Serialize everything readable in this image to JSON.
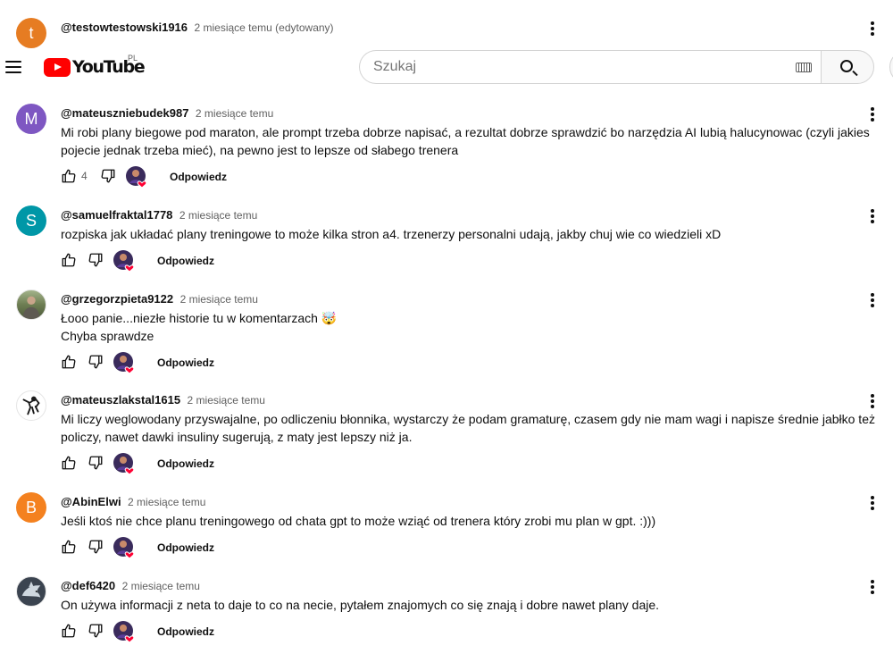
{
  "masthead": {
    "logo_text": "YouTube",
    "region": "PL",
    "search_placeholder": "Szukaj"
  },
  "top_comment": {
    "avatar_letter": "t",
    "avatar_color": "#e67c22",
    "author": "@testowtestowski1916",
    "time": "2 miesiące temu (edytowany)"
  },
  "reply_label": "Odpowiedz",
  "comments": [
    {
      "author": "@mateuszniebudek987",
      "time": "2 miesiące temu",
      "avatar_letter": "M",
      "avatar_color": "#7e57c2",
      "text": "Mi robi plany biegowe pod maraton, ale prompt trzeba dobrze napisać, a rezultat dobrze sprawdzić bo narzędzia AI lubią halucynowac (czyli jakies pojecie jednak trzeba mieć), na pewno jest to lepsze od słabego trenera",
      "likes": "4"
    },
    {
      "author": "@samuelfraktal1778",
      "time": "2 miesiące temu",
      "avatar_letter": "S",
      "avatar_color": "#0097a7",
      "text": "rozpiska jak układać plany treningowe to może kilka stron a4. trzenerzy personalni udają, jakby chuj wie co wiedzieli xD",
      "likes": ""
    },
    {
      "author": "@grzegorzpieta9122",
      "time": "2 miesiące temu",
      "avatar_letter": "",
      "avatar_color": "#7a8a5a",
      "text_line1": "Łooo panie...niezłe historie tu w komentarzach 🤯",
      "text_line2": "Chyba sprawdze",
      "likes": ""
    },
    {
      "author": "@mateuszlakstal1615",
      "time": "2 miesiące temu",
      "avatar_letter": "",
      "avatar_color": "#ffffff",
      "text": "Mi liczy weglowodany przyswajalne, po odliczeniu błonnika, wystarczy że podam gramaturę, czasem gdy nie mam wagi i napisze średnie jabłko też policzy, nawet dawki insuliny sugerują, z maty jest lepszy niż ja.",
      "likes": ""
    },
    {
      "author": "@AbinElwi",
      "time": "2 miesiące temu",
      "avatar_letter": "B",
      "avatar_color": "#f4811f",
      "text": "Jeśli ktoś nie chce planu treningowego od chata gpt to może wziąć od trenera który zrobi mu plan w gpt. :)))",
      "likes": ""
    },
    {
      "author": "@def6420",
      "time": "2 miesiące temu",
      "avatar_letter": "",
      "avatar_color": "#3b4450",
      "text": "On używa informacji z neta to daje to co na necie, pytałem znajomych co się znają i dobre nawet plany daje.",
      "likes": ""
    }
  ]
}
